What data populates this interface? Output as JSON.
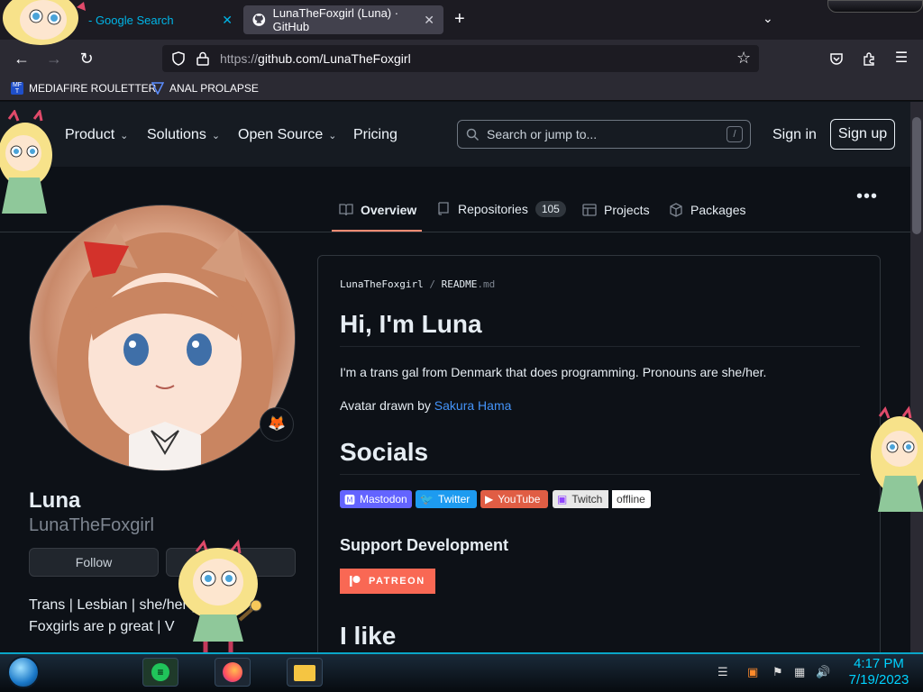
{
  "browser": {
    "tabs": [
      {
        "title": "- Google Search"
      },
      {
        "title": "LunaTheFoxgirl (Luna) · GitHub"
      }
    ],
    "url_prefix": "https://",
    "url_rest": "github.com/LunaTheFoxgirl",
    "bookmarks": [
      "MEDIAFIRE ROULETTER",
      "ANAL PROLAPSE"
    ]
  },
  "gh_header": {
    "nav": [
      "Product",
      "Solutions",
      "Open Source",
      "Pricing"
    ],
    "search_placeholder": "Search or jump to...",
    "search_shortcut": "/",
    "sign_in": "Sign in",
    "sign_up": "Sign up"
  },
  "profile_tabs": [
    {
      "label": "Overview"
    },
    {
      "label": "Repositories",
      "count": "105"
    },
    {
      "label": "Projects"
    },
    {
      "label": "Packages"
    }
  ],
  "profile": {
    "name": "Luna",
    "username": "LunaTheFoxgirl",
    "follow": "Follow",
    "bio": "Trans | Lesbian | she/her | C# dev | Foxgirls are p great | V",
    "status_emoji": "🦊"
  },
  "readme": {
    "path_user": "LunaTheFoxgirl",
    "path_sep": "/",
    "path_file": "README",
    "path_ext": ".md",
    "title": "Hi, I'm Luna",
    "intro": "I'm a trans gal from Denmark that does programming. Pronouns are she/her.",
    "avatar_prefix": "Avatar drawn by ",
    "avatar_artist": "Sakura Hama",
    "socials_heading": "Socials",
    "socials": [
      "Mastodon",
      "Twitter",
      "YouTube",
      "Twitch",
      "offline"
    ],
    "support_heading": "Support Development",
    "patreon": "PATREON",
    "like_heading": "I like"
  },
  "taskbar": {
    "time": "4:17 PM",
    "date": "7/19/2023"
  },
  "colors": {
    "accent_link": "#4493f8",
    "tab_underline": "#fd8c73",
    "patreon": "#f96854",
    "mastodon": "#6364ff",
    "twitter": "#1d9bf0",
    "youtube": "#e05d44",
    "twitch": "#9146ff"
  }
}
